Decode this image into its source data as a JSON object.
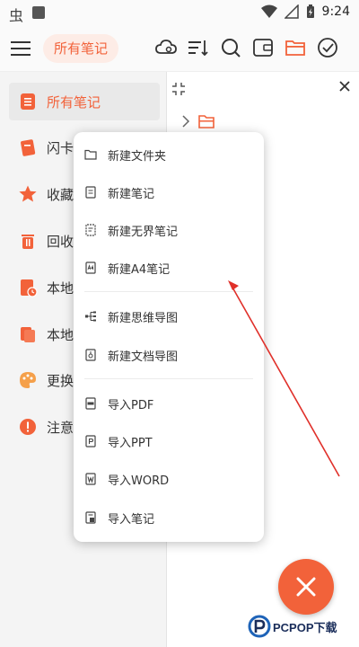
{
  "status_bar": {
    "bug_glyph": "虫",
    "time": "9:24"
  },
  "toolbar": {
    "title": "所有笔记"
  },
  "sidebar": {
    "items": [
      {
        "label": "所有笔记",
        "icon": "note-icon",
        "active": true
      },
      {
        "label": "闪卡",
        "icon": "flashcard-icon"
      },
      {
        "label": "收藏",
        "icon": "star-icon"
      },
      {
        "label": "回收",
        "icon": "trash-icon"
      },
      {
        "label": "本地",
        "icon": "local-clock-icon"
      },
      {
        "label": "本地",
        "icon": "local-copy-icon"
      },
      {
        "label": "更换",
        "icon": "palette-icon"
      },
      {
        "label": "注意",
        "icon": "alert-icon"
      }
    ]
  },
  "popup_menu": {
    "items": [
      {
        "label": "新建文件夹",
        "icon": "folder-icon"
      },
      {
        "label": "新建笔记",
        "icon": "note-outline-icon"
      },
      {
        "label": "新建无界笔记",
        "icon": "infinite-note-icon"
      },
      {
        "label": "新建A4笔记",
        "icon": "a4-note-icon"
      },
      {
        "label": "新建思维导图",
        "icon": "mindmap-icon"
      },
      {
        "label": "新建文档导图",
        "icon": "doc-map-icon"
      },
      {
        "label": "导入PDF",
        "icon": "pdf-icon"
      },
      {
        "label": "导入PPT",
        "icon": "ppt-icon"
      },
      {
        "label": "导入WORD",
        "icon": "word-icon"
      },
      {
        "label": "导入笔记",
        "icon": "import-note-icon"
      }
    ]
  },
  "watermark": {
    "text": "PCPOP下载"
  },
  "colors": {
    "accent": "#f2623a",
    "sidebar_bg": "#f4f4f4",
    "arrow": "#e0302a"
  }
}
